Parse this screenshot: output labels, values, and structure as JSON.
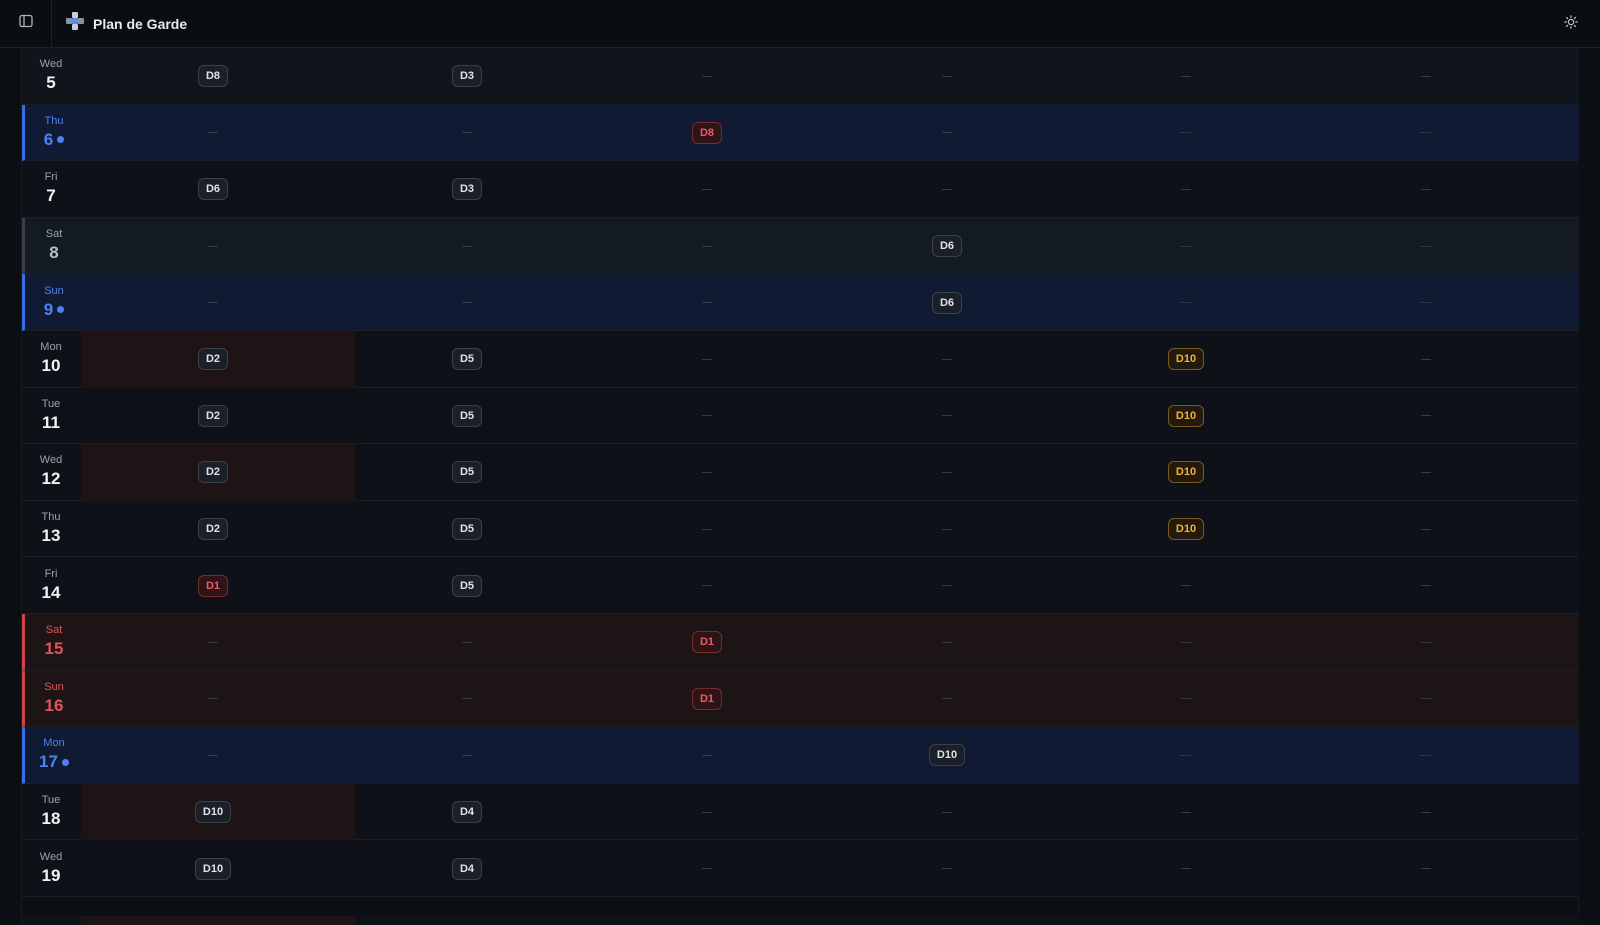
{
  "app": {
    "title": "Plan de Garde"
  },
  "colors": {
    "accent": "#4d82f0",
    "holiday": "#e0535a",
    "amber": "#f0b33a"
  },
  "rows": [
    {
      "dow": "Wed",
      "day": "5",
      "style": "weekday-alt",
      "dot": false,
      "shade": false,
      "cells": [
        "D8",
        "D3",
        "",
        "",
        "",
        ""
      ],
      "tones": [
        "",
        "",
        "",
        "",
        "",
        ""
      ]
    },
    {
      "dow": "Thu",
      "day": "6",
      "style": "today-blue",
      "dot": true,
      "shade": false,
      "cells": [
        "",
        "",
        "D8",
        "",
        "",
        ""
      ],
      "tones": [
        "",
        "",
        "red",
        "",
        "",
        ""
      ]
    },
    {
      "dow": "Fri",
      "day": "7",
      "style": "",
      "dot": false,
      "shade": false,
      "cells": [
        "D6",
        "D3",
        "",
        "",
        "",
        ""
      ],
      "tones": [
        "",
        "",
        "",
        "",
        "",
        ""
      ]
    },
    {
      "dow": "Sat",
      "day": "8",
      "style": "sat-plain",
      "dot": false,
      "shade": false,
      "cells": [
        "",
        "",
        "",
        "D6",
        "",
        ""
      ],
      "tones": [
        "",
        "",
        "",
        "",
        "",
        ""
      ]
    },
    {
      "dow": "Sun",
      "day": "9",
      "style": "today-blue",
      "dot": true,
      "shade": false,
      "cells": [
        "",
        "",
        "",
        "D6",
        "",
        ""
      ],
      "tones": [
        "",
        "",
        "",
        "",
        "",
        ""
      ]
    },
    {
      "dow": "Mon",
      "day": "10",
      "style": "",
      "dot": false,
      "shade": true,
      "cells": [
        "D2",
        "D5",
        "",
        "",
        "D10",
        ""
      ],
      "tones": [
        "",
        "",
        "",
        "",
        "amber",
        ""
      ]
    },
    {
      "dow": "Tue",
      "day": "11",
      "style": "",
      "dot": false,
      "shade": false,
      "cells": [
        "D2",
        "D5",
        "",
        "",
        "D10",
        ""
      ],
      "tones": [
        "",
        "",
        "",
        "",
        "amber",
        ""
      ]
    },
    {
      "dow": "Wed",
      "day": "12",
      "style": "",
      "dot": false,
      "shade": true,
      "cells": [
        "D2",
        "D5",
        "",
        "",
        "D10",
        ""
      ],
      "tones": [
        "",
        "",
        "",
        "",
        "amber",
        ""
      ]
    },
    {
      "dow": "Thu",
      "day": "13",
      "style": "",
      "dot": false,
      "shade": false,
      "cells": [
        "D2",
        "D5",
        "",
        "",
        "D10",
        ""
      ],
      "tones": [
        "",
        "",
        "",
        "",
        "amber",
        ""
      ]
    },
    {
      "dow": "Fri",
      "day": "14",
      "style": "",
      "dot": false,
      "shade": false,
      "cells": [
        "D1",
        "D5",
        "",
        "",
        "",
        ""
      ],
      "tones": [
        "red",
        "",
        "",
        "",
        "",
        ""
      ]
    },
    {
      "dow": "Sat",
      "day": "15",
      "style": "holiday",
      "dot": false,
      "shade": false,
      "cells": [
        "",
        "",
        "D1",
        "",
        "",
        ""
      ],
      "tones": [
        "",
        "",
        "red",
        "",
        "",
        ""
      ]
    },
    {
      "dow": "Sun",
      "day": "16",
      "style": "holiday",
      "dot": false,
      "shade": false,
      "cells": [
        "",
        "",
        "D1",
        "",
        "",
        ""
      ],
      "tones": [
        "",
        "",
        "red",
        "",
        "",
        ""
      ]
    },
    {
      "dow": "Mon",
      "day": "17",
      "style": "today-blue",
      "dot": true,
      "shade": false,
      "cells": [
        "",
        "",
        "",
        "D10",
        "",
        ""
      ],
      "tones": [
        "",
        "",
        "",
        "",
        "",
        ""
      ]
    },
    {
      "dow": "Tue",
      "day": "18",
      "style": "",
      "dot": false,
      "shade": true,
      "cells": [
        "D10",
        "D4",
        "",
        "",
        "",
        ""
      ],
      "tones": [
        "",
        "",
        "",
        "",
        "",
        ""
      ]
    },
    {
      "dow": "Wed",
      "day": "19",
      "style": "",
      "dot": false,
      "shade": false,
      "cells": [
        "D10",
        "D4",
        "",
        "",
        "",
        ""
      ],
      "tones": [
        "",
        "",
        "",
        "",
        "",
        ""
      ]
    }
  ]
}
